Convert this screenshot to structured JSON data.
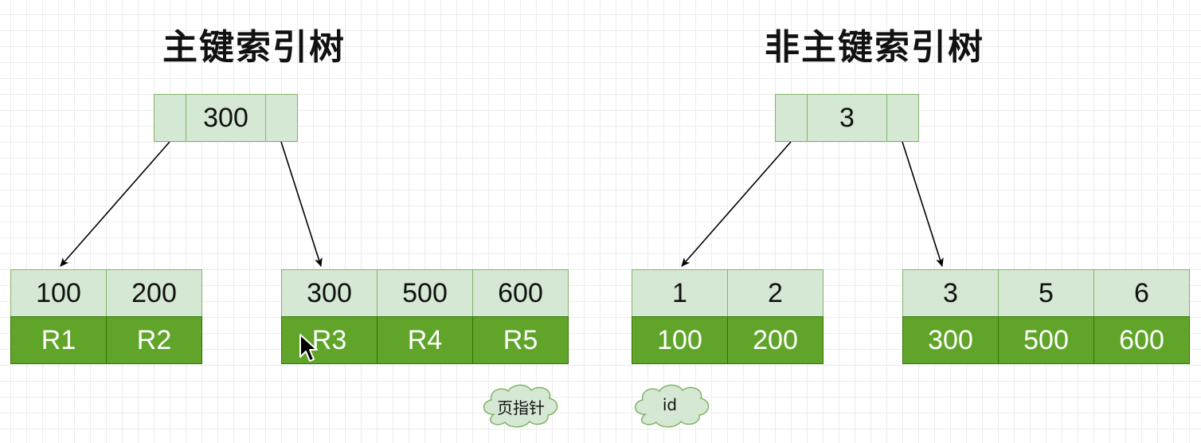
{
  "titles": {
    "primary": "主键索引树",
    "secondary": "非主键索引树"
  },
  "primary_tree": {
    "root": {
      "cells": [
        "",
        "300",
        ""
      ]
    },
    "leaf_left": {
      "keys": [
        "100",
        "200"
      ],
      "values": [
        "R1",
        "R2"
      ]
    },
    "leaf_right": {
      "keys": [
        "300",
        "500",
        "600"
      ],
      "values": [
        "R3",
        "R4",
        "R5"
      ]
    }
  },
  "secondary_tree": {
    "root": {
      "cells": [
        "",
        "3",
        ""
      ]
    },
    "leaf_left": {
      "keys": [
        "1",
        "2"
      ],
      "values": [
        "100",
        "200"
      ]
    },
    "leaf_right": {
      "keys": [
        "3",
        "5",
        "6"
      ],
      "values": [
        "300",
        "500",
        "600"
      ]
    }
  },
  "legend": {
    "page_pointer": "页指针",
    "id": "id"
  },
  "colors": {
    "key_fill": "#d5e8d4",
    "key_stroke": "#82b366",
    "value_fill": "#60a52a",
    "value_stroke": "#2d7600",
    "cloud_fill": "#d5e8d4",
    "cloud_stroke": "#82b366"
  }
}
